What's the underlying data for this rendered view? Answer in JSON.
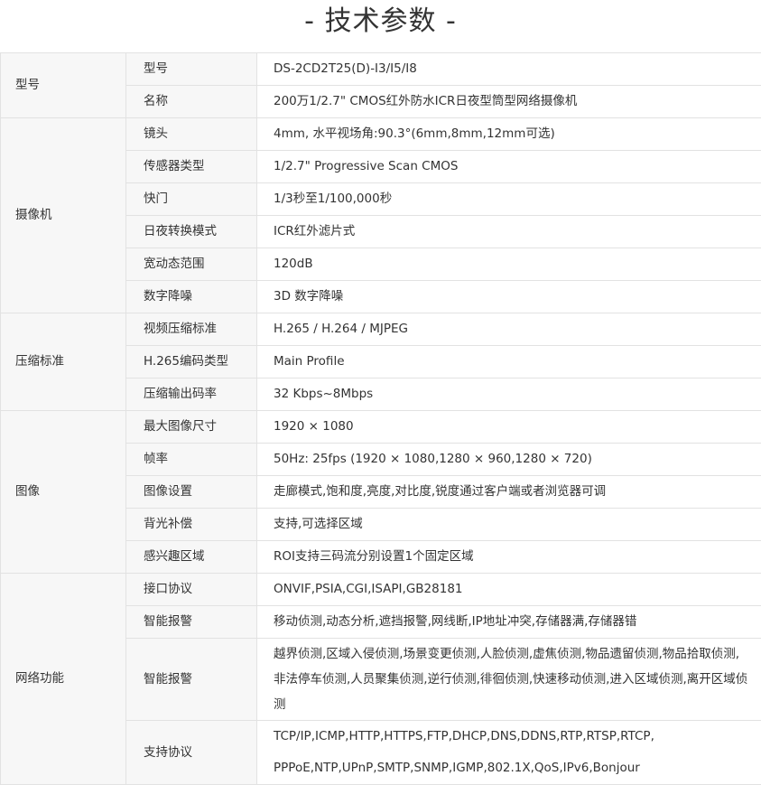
{
  "title": "- 技术参数 -",
  "groups": [
    {
      "category": "型号",
      "rows": [
        {
          "key": "型号",
          "value": "DS-2CD2T25(D)-I3/I5/I8"
        },
        {
          "key": "名称",
          "value": "200万1/2.7\" CMOS红外防水ICR日夜型筒型网络摄像机"
        }
      ]
    },
    {
      "category": "摄像机",
      "rows": [
        {
          "key": "镜头",
          "value": "4mm, 水平视场角:90.3°(6mm,8mm,12mm可选)"
        },
        {
          "key": "传感器类型",
          "value": "1/2.7\" Progressive Scan CMOS"
        },
        {
          "key": "快门",
          "value": "1/3秒至1/100,000秒"
        },
        {
          "key": "日夜转换模式",
          "value": "ICR红外滤片式"
        },
        {
          "key": "宽动态范围",
          "value": "120dB"
        },
        {
          "key": "数字降噪",
          "value": "3D 数字降噪"
        }
      ]
    },
    {
      "category": "压缩标准",
      "rows": [
        {
          "key": "视频压缩标准",
          "value": "H.265 / H.264 / MJPEG"
        },
        {
          "key": "H.265编码类型",
          "value": "Main Profile"
        },
        {
          "key": "压缩输出码率",
          "value": "32 Kbps~8Mbps"
        }
      ]
    },
    {
      "category": "图像",
      "rows": [
        {
          "key": "最大图像尺寸",
          "value": "1920 × 1080"
        },
        {
          "key": "帧率",
          "value": "50Hz: 25fps (1920 × 1080,1280 × 960,1280 × 720)"
        },
        {
          "key": "图像设置",
          "value": "走廊模式,饱和度,亮度,对比度,锐度通过客户端或者浏览器可调"
        },
        {
          "key": "背光补偿",
          "value": "支持,可选择区域"
        },
        {
          "key": "感兴趣区域",
          "value": "ROI支持三码流分别设置1个固定区域"
        }
      ]
    },
    {
      "category": "网络功能",
      "rows": [
        {
          "key": "接口协议",
          "value": "ONVIF,PSIA,CGI,ISAPI,GB28181"
        },
        {
          "key": "智能报警",
          "value": "移动侦测,动态分析,遮挡报警,网线断,IP地址冲突,存储器满,存储器错"
        },
        {
          "key": "智能报警",
          "lines": [
            "越界侦测,区域入侵侦测,场景变更侦测,人脸侦测,虚焦侦测,物品遗留侦测,物品拾取侦测,",
            "非法停车侦测,人员聚集侦测,逆行侦测,徘徊侦测,快速移动侦测,进入区域侦测,离开区域侦",
            "测"
          ]
        },
        {
          "key": "支持协议",
          "lines": [
            "TCP/IP,ICMP,HTTP,HTTPS,FTP,DHCP,DNS,DDNS,RTP,RTSP,RTCP,",
            "PPPoE,NTP,UPnP,SMTP,SNMP,IGMP,802.1X,QoS,IPv6,Bonjour"
          ]
        }
      ]
    }
  ]
}
